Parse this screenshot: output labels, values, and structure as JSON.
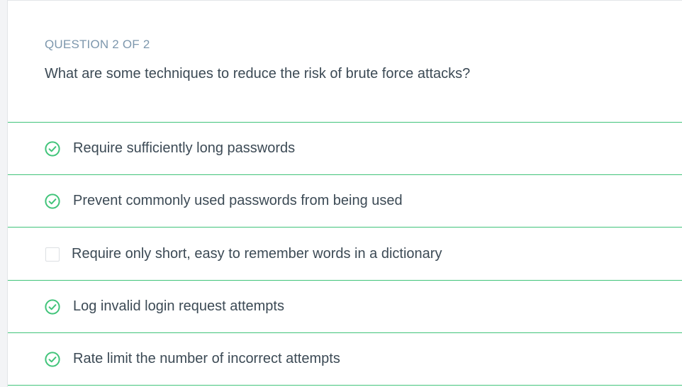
{
  "question": {
    "counter": "QUESTION 2 OF 2",
    "prompt": "What are some techniques to reduce the risk of brute force attacks?"
  },
  "options": [
    {
      "label": "Require sufficiently long passwords",
      "status": "correct",
      "icon": "check-circle-icon"
    },
    {
      "label": "Prevent commonly used passwords from being used",
      "status": "correct",
      "icon": "check-circle-icon"
    },
    {
      "label": "Require only short, easy to remember words in a dictionary",
      "status": "unselected",
      "icon": "empty-checkbox-icon"
    },
    {
      "label": "Log invalid login request attempts",
      "status": "correct",
      "icon": "check-circle-icon"
    },
    {
      "label": "Rate limit the number of incorrect attempts",
      "status": "correct",
      "icon": "check-circle-icon"
    }
  ],
  "colors": {
    "correct": "#41c47a",
    "header": "#7d97ad",
    "text": "#3c4a55"
  }
}
